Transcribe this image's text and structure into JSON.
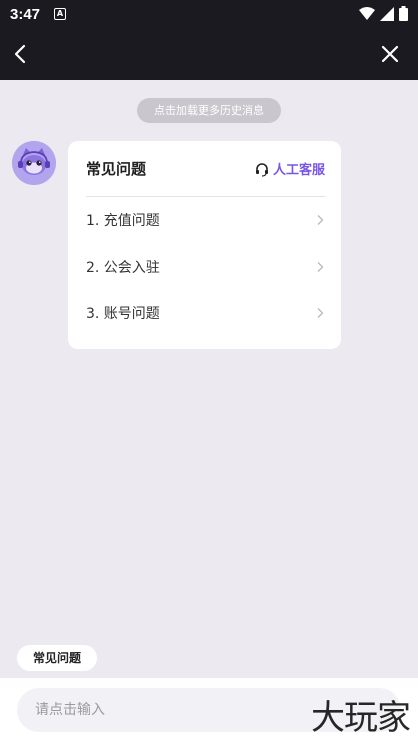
{
  "status_bar": {
    "time": "3:47",
    "notif_glyph": "A"
  },
  "header": {
    "title": "",
    "back_icon": "chevron-left-icon",
    "close_icon": "close-icon"
  },
  "history_link": "点击加载更多历史消息",
  "faq_card": {
    "title": "常见问题",
    "agent_label": "人工客服",
    "items": [
      {
        "label": "1. 充值问题"
      },
      {
        "label": "2. 公会入驻"
      },
      {
        "label": "3. 账号问题"
      }
    ]
  },
  "quick_chip": "常见问题",
  "input": {
    "placeholder": "请点击输入",
    "value": ""
  },
  "watermark": "大玩家",
  "colors": {
    "accent": "#7a56e6",
    "header_bg": "#1c1a21",
    "page_bg": "#eceaf0"
  }
}
